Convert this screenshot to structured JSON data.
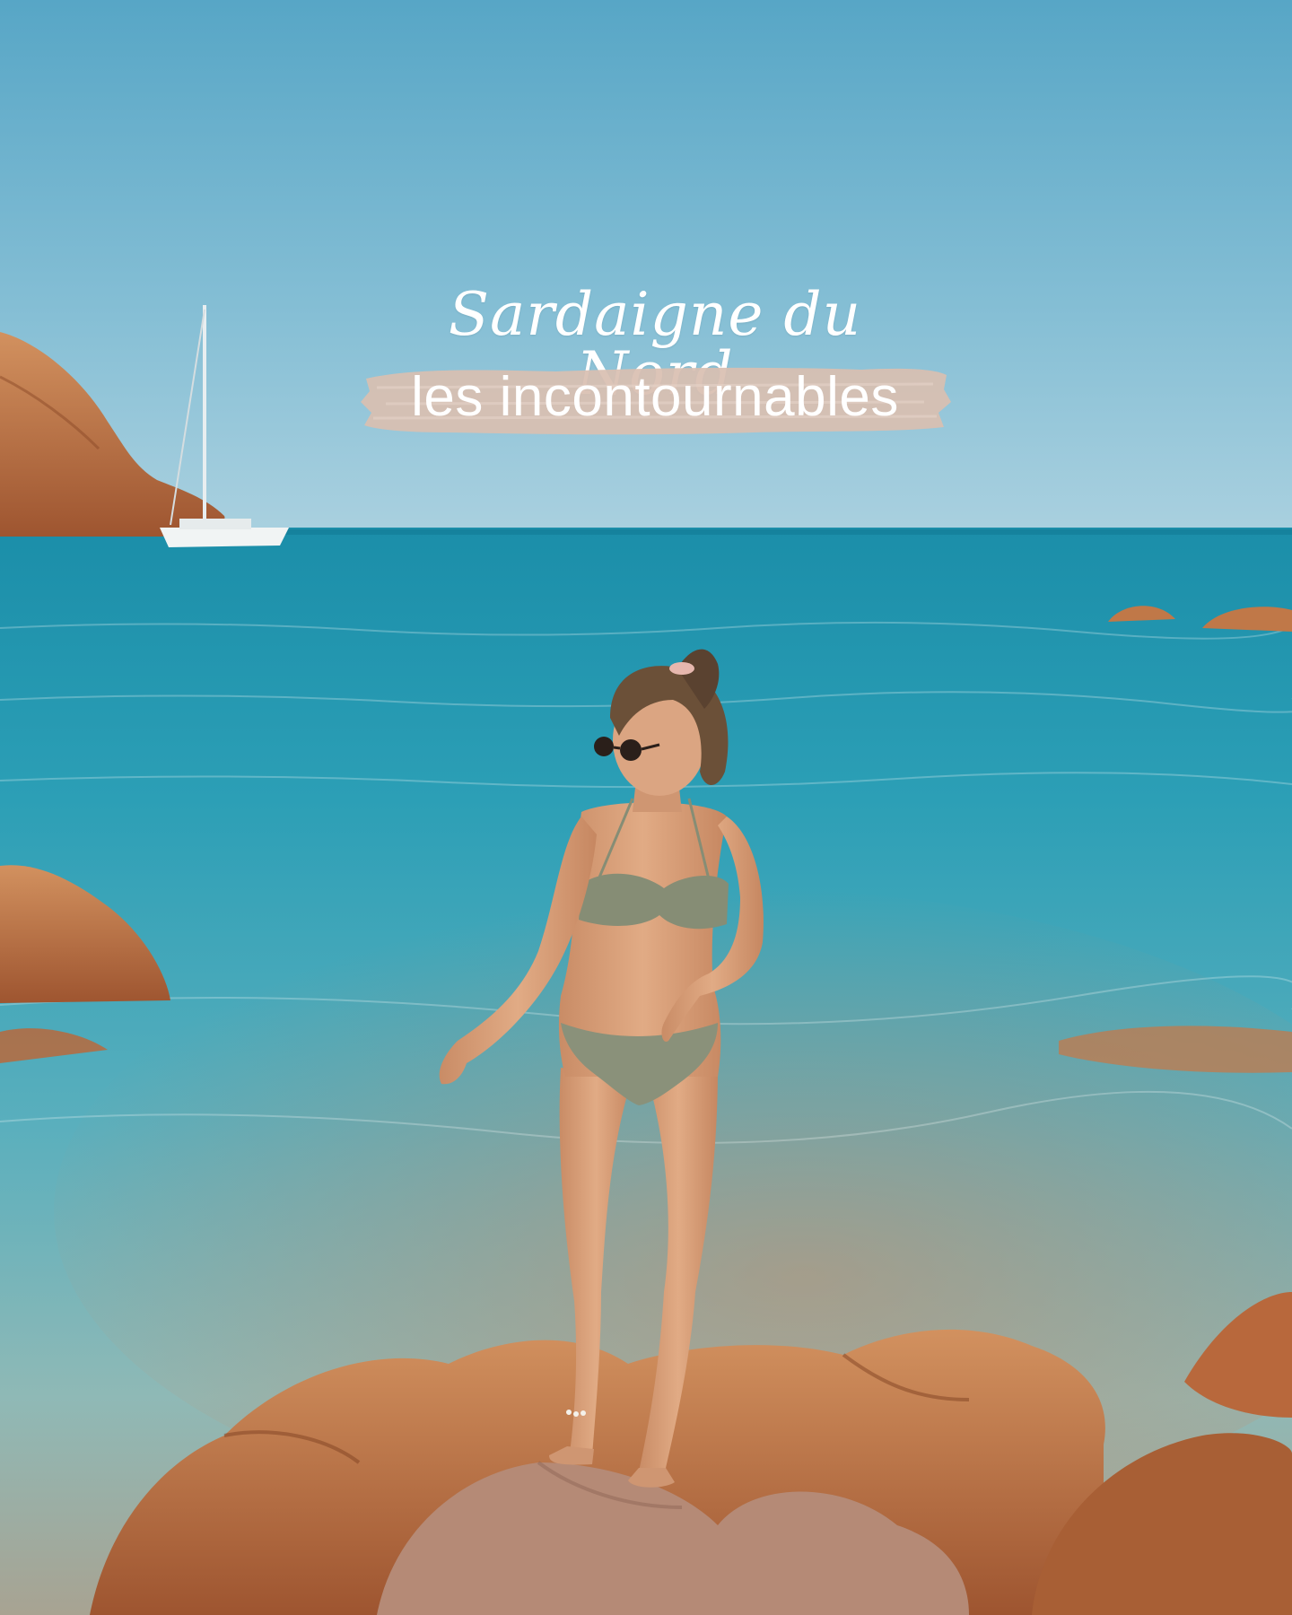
{
  "overlay": {
    "title": "Sardaigne du Nord",
    "subtitle": "les incontournables"
  },
  "colors": {
    "sky_top": "#5aa8c8",
    "sky_bottom": "#a9cfde",
    "sea_deep": "#1e8fa8",
    "sea_shallow": "#6fb8c0",
    "rock": "#b8683c",
    "rock_light": "#d08a5c",
    "brush_stroke": "#d9bfb1",
    "swimsuit": "#8a917a",
    "skin": "#d9a07a"
  }
}
